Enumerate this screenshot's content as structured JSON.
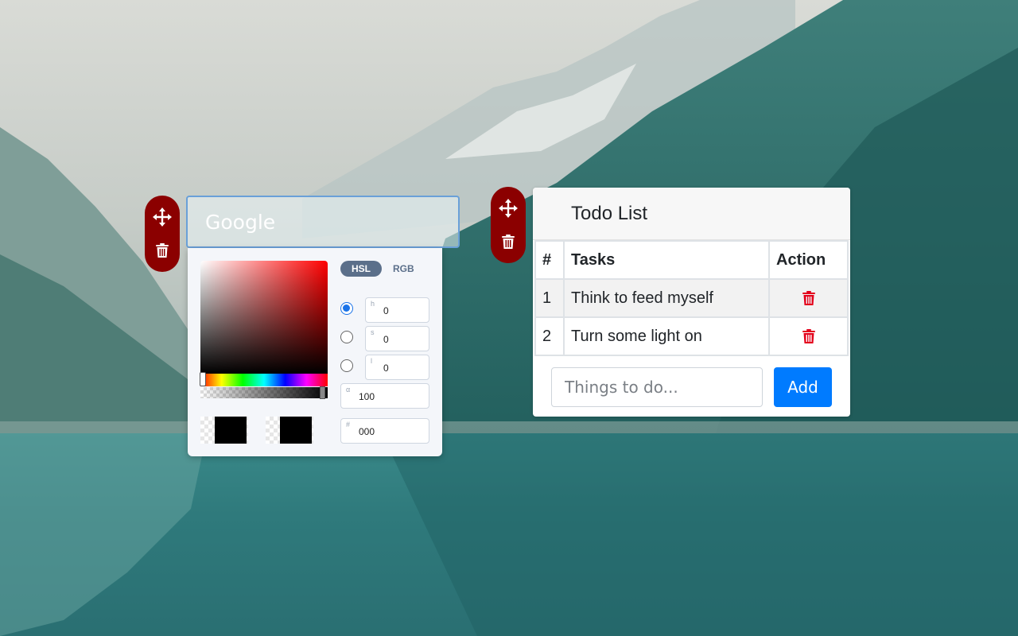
{
  "colors": {
    "handle": "#8b0000",
    "accent_blue": "#007bff",
    "trash_red": "#e3001b"
  },
  "icons": {
    "move": "move-arrows-icon",
    "trash": "trash-icon"
  },
  "search_widget": {
    "text": "Google"
  },
  "color_picker": {
    "modes": [
      "HSL",
      "RGB"
    ],
    "active_mode": "HSL",
    "fields": {
      "h": {
        "label": "h",
        "value": "0"
      },
      "s": {
        "label": "s",
        "value": "0"
      },
      "l": {
        "label": "l",
        "value": "0"
      },
      "alpha": {
        "label": "α",
        "value": "100"
      },
      "hex": {
        "label": "#",
        "value": "000"
      }
    },
    "selected_channel": "h",
    "current_color": "#000000",
    "previous_color": "#000000"
  },
  "todo": {
    "title": "Todo List",
    "columns": [
      "#",
      "Tasks",
      "Action"
    ],
    "rows": [
      {
        "num": "1",
        "task": "Think to feed myself"
      },
      {
        "num": "2",
        "task": "Turn some light on"
      }
    ],
    "input_placeholder": "Things to do...",
    "add_label": "Add"
  }
}
